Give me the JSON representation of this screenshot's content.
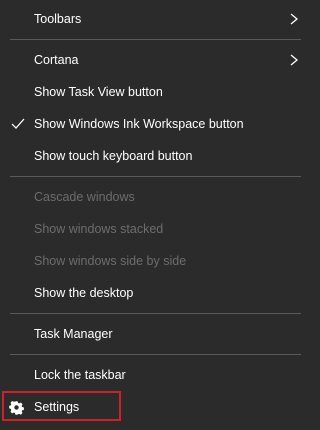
{
  "menu": {
    "items": [
      {
        "label": "Toolbars",
        "submenu": true
      },
      {
        "label": "Cortana",
        "submenu": true
      },
      {
        "label": "Show Task View button"
      },
      {
        "label": "Show Windows Ink Workspace button",
        "checked": true
      },
      {
        "label": "Show touch keyboard button"
      },
      {
        "label": "Cascade windows",
        "disabled": true
      },
      {
        "label": "Show windows stacked",
        "disabled": true
      },
      {
        "label": "Show windows side by side",
        "disabled": true
      },
      {
        "label": "Show the desktop"
      },
      {
        "label": "Task Manager"
      },
      {
        "label": "Lock the taskbar"
      },
      {
        "label": "Settings",
        "icon": "gear-icon"
      }
    ]
  },
  "colors": {
    "background": "#2b2b2b",
    "text": "#ffffff",
    "disabled_text": "#6d6d6d",
    "separator": "#5a5a5a",
    "highlight_border": "#d0202a"
  }
}
